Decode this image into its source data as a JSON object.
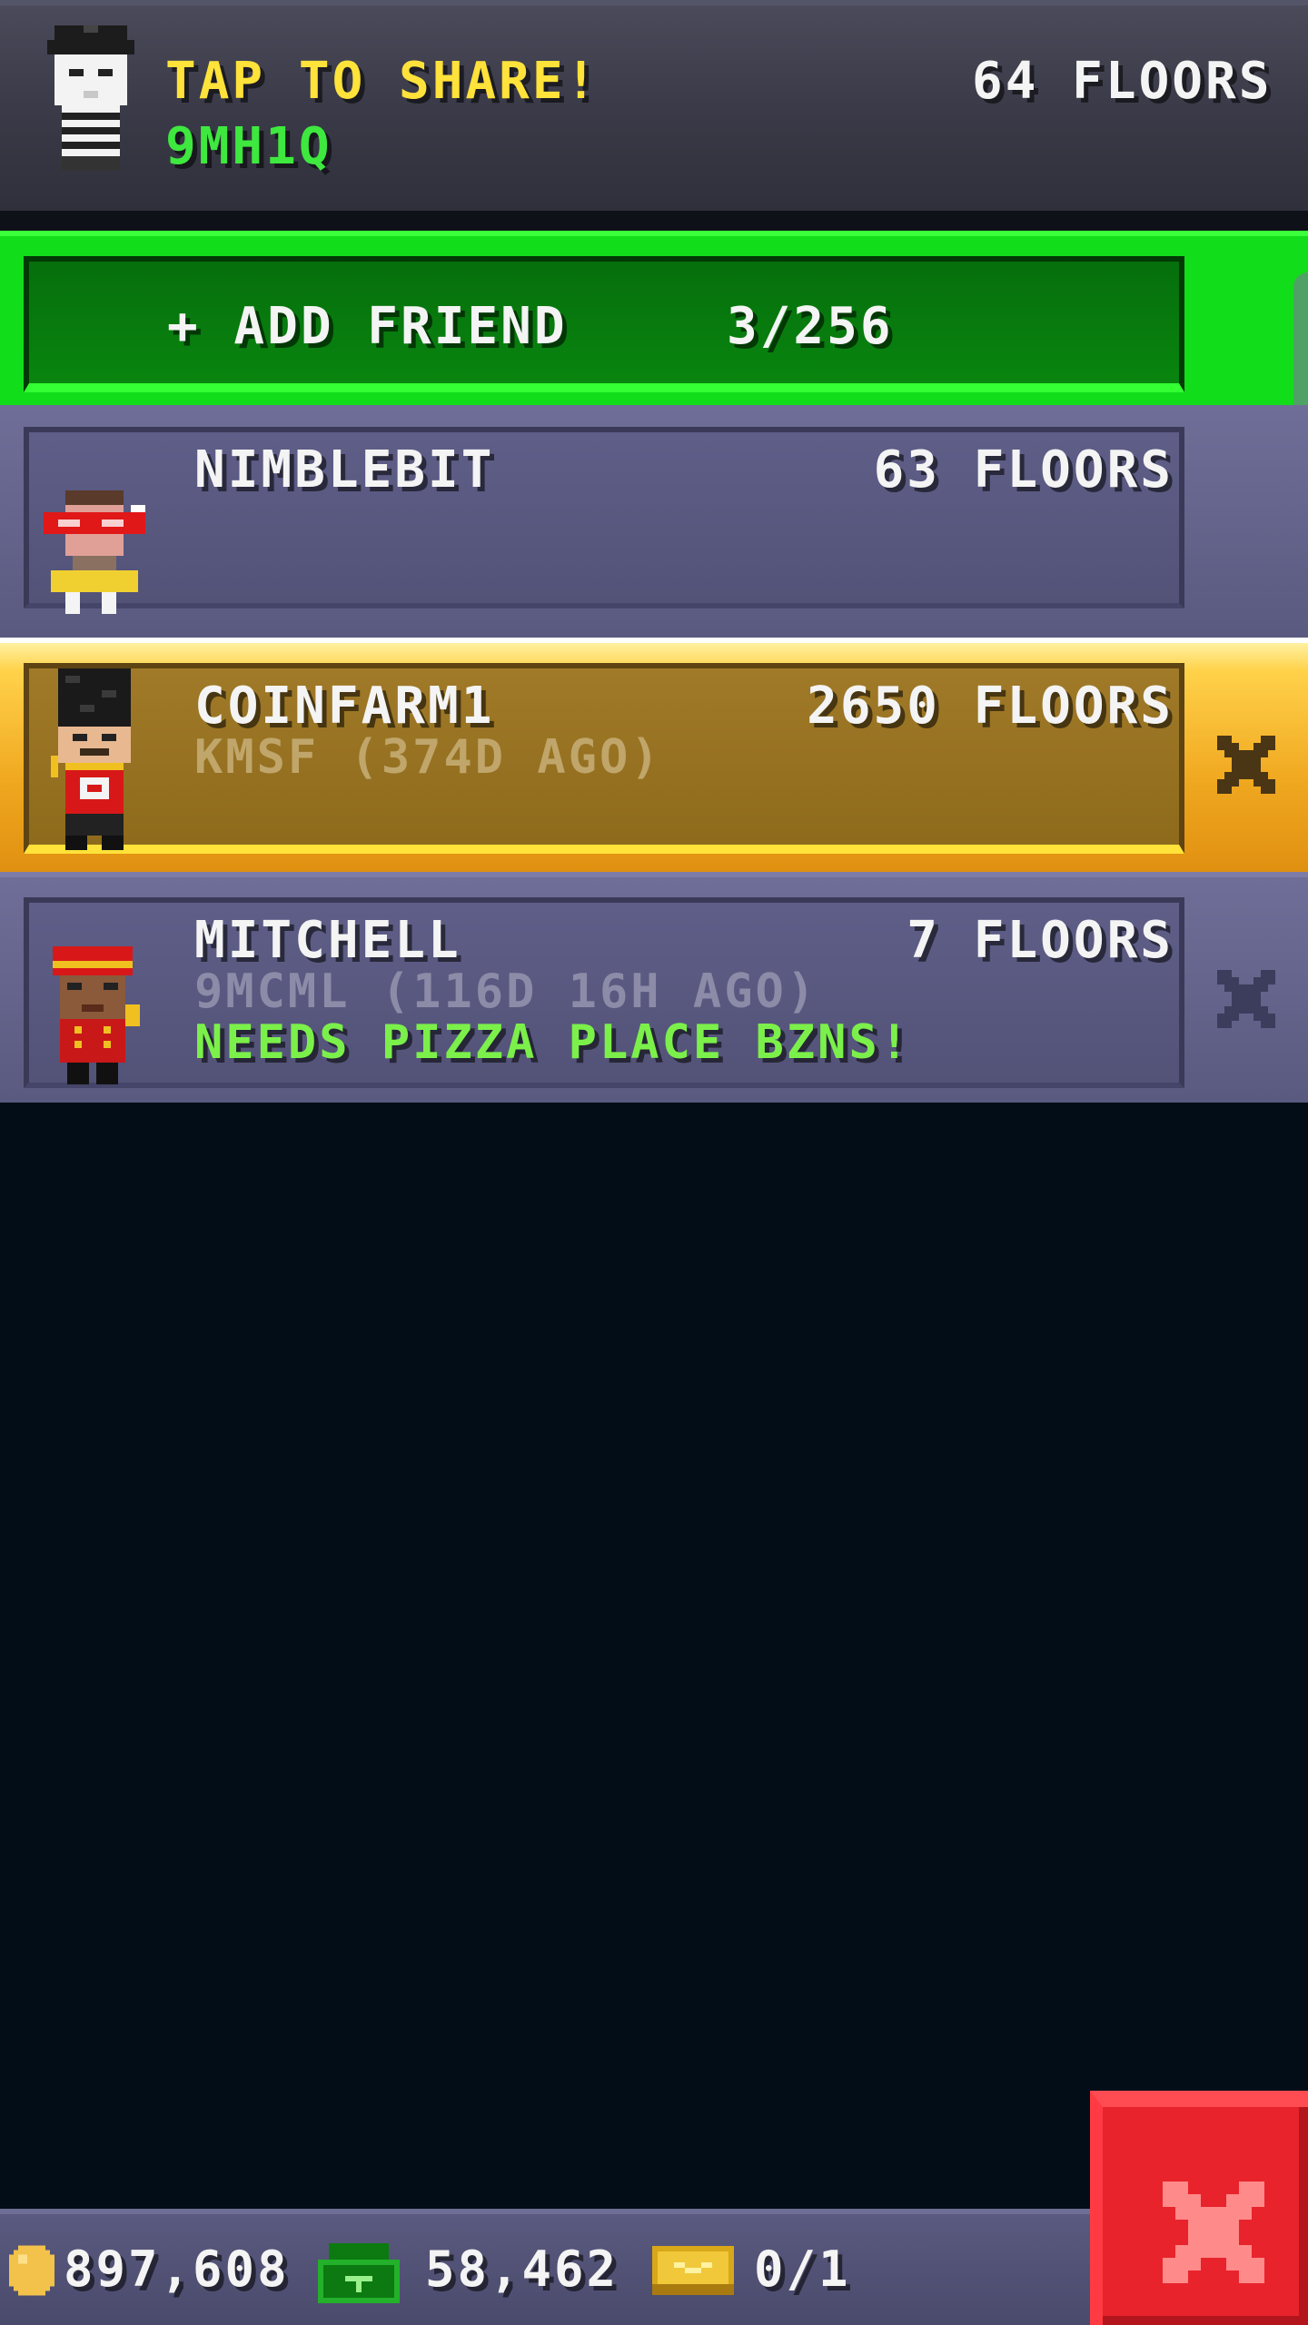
{
  "header": {
    "share_label": "TAP TO SHARE!",
    "player_code": "9MH1Q",
    "player_floors": "64 FLOORS"
  },
  "add_friend": {
    "label": "+ ADD FRIEND",
    "count": "3/256"
  },
  "friends": [
    {
      "name": "NIMBLEBIT",
      "floors": "63 FLOORS",
      "code": "",
      "status": ""
    },
    {
      "name": "COINFARM1",
      "floors": "2650 FLOORS",
      "code": "KMSF (374D AGO)",
      "status": ""
    },
    {
      "name": "MITCHELL",
      "floors": "7 FLOORS",
      "code": "9MCML (116D 16H AGO)",
      "status": "NEEDS PIZZA PLACE BZNS!"
    }
  ],
  "footer": {
    "coins": "897,608",
    "bux": "58,462",
    "tickets": "0/1"
  },
  "icons": {
    "coin": "coin-icon",
    "bux": "bux-icon",
    "ticket": "ticket-icon",
    "remove": "remove-x-icon",
    "close": "close-icon"
  },
  "colors": {
    "share_text": "#ffe23a",
    "code_text": "#3ee83e",
    "status_text": "#7cf04a",
    "add_friend_bg": "#0b8f12",
    "row_bg": "#5a5a80",
    "highlight_row_bg": "#9a7424",
    "close_button": "#e8232c"
  }
}
